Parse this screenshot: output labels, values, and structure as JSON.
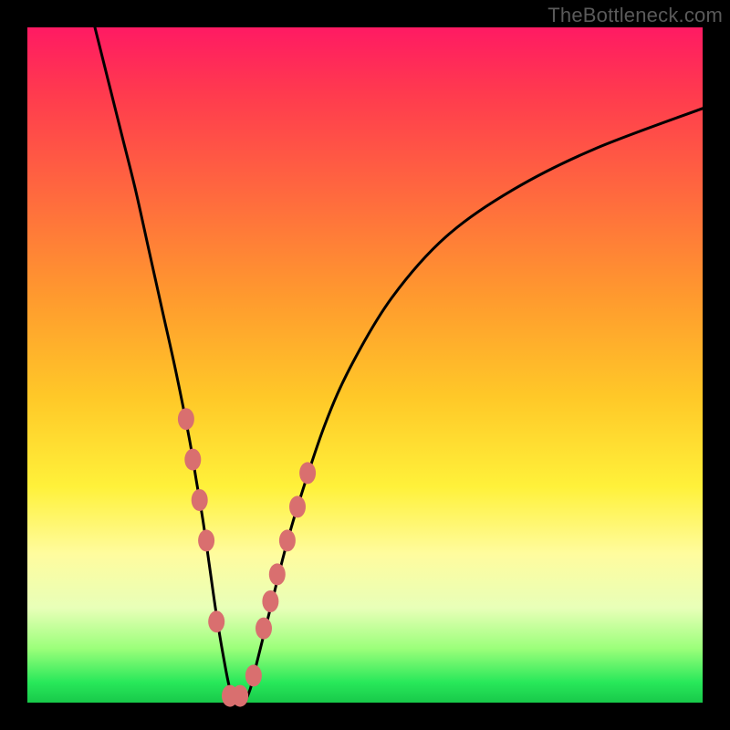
{
  "watermark": "TheBottleneck.com",
  "chart_data": {
    "type": "line",
    "title": "",
    "xlabel": "",
    "ylabel": "",
    "xlim": [
      0,
      100
    ],
    "ylim": [
      0,
      100
    ],
    "grid": false,
    "series": [
      {
        "name": "bottleneck-curve",
        "x": [
          10,
          12,
          14,
          16,
          18,
          20,
          22,
          24,
          25,
          26,
          27,
          28,
          29,
          30,
          31,
          32,
          33,
          34,
          36,
          38,
          40,
          44,
          48,
          54,
          62,
          72,
          84,
          100
        ],
        "values": [
          100,
          92,
          84,
          76,
          67,
          58,
          49,
          39,
          33,
          27,
          20,
          13,
          7,
          2,
          0,
          0,
          2,
          6,
          14,
          22,
          29,
          41,
          50,
          60,
          69,
          76,
          82,
          88
        ]
      }
    ],
    "markers": {
      "name": "highlight-points",
      "x": [
        23.5,
        24.5,
        25.5,
        26.5,
        28.0,
        30.0,
        31.5,
        33.5,
        35.0,
        36.0,
        37.0,
        38.5,
        40.0,
        41.5
      ],
      "values": [
        42,
        36,
        30,
        24,
        12,
        1,
        1,
        4,
        11,
        15,
        19,
        24,
        29,
        34
      ]
    },
    "colors": {
      "curve": "#000000",
      "markers": "#d96f6f",
      "gradient_top": "#ff1a63",
      "gradient_bottom": "#18c94a"
    }
  }
}
